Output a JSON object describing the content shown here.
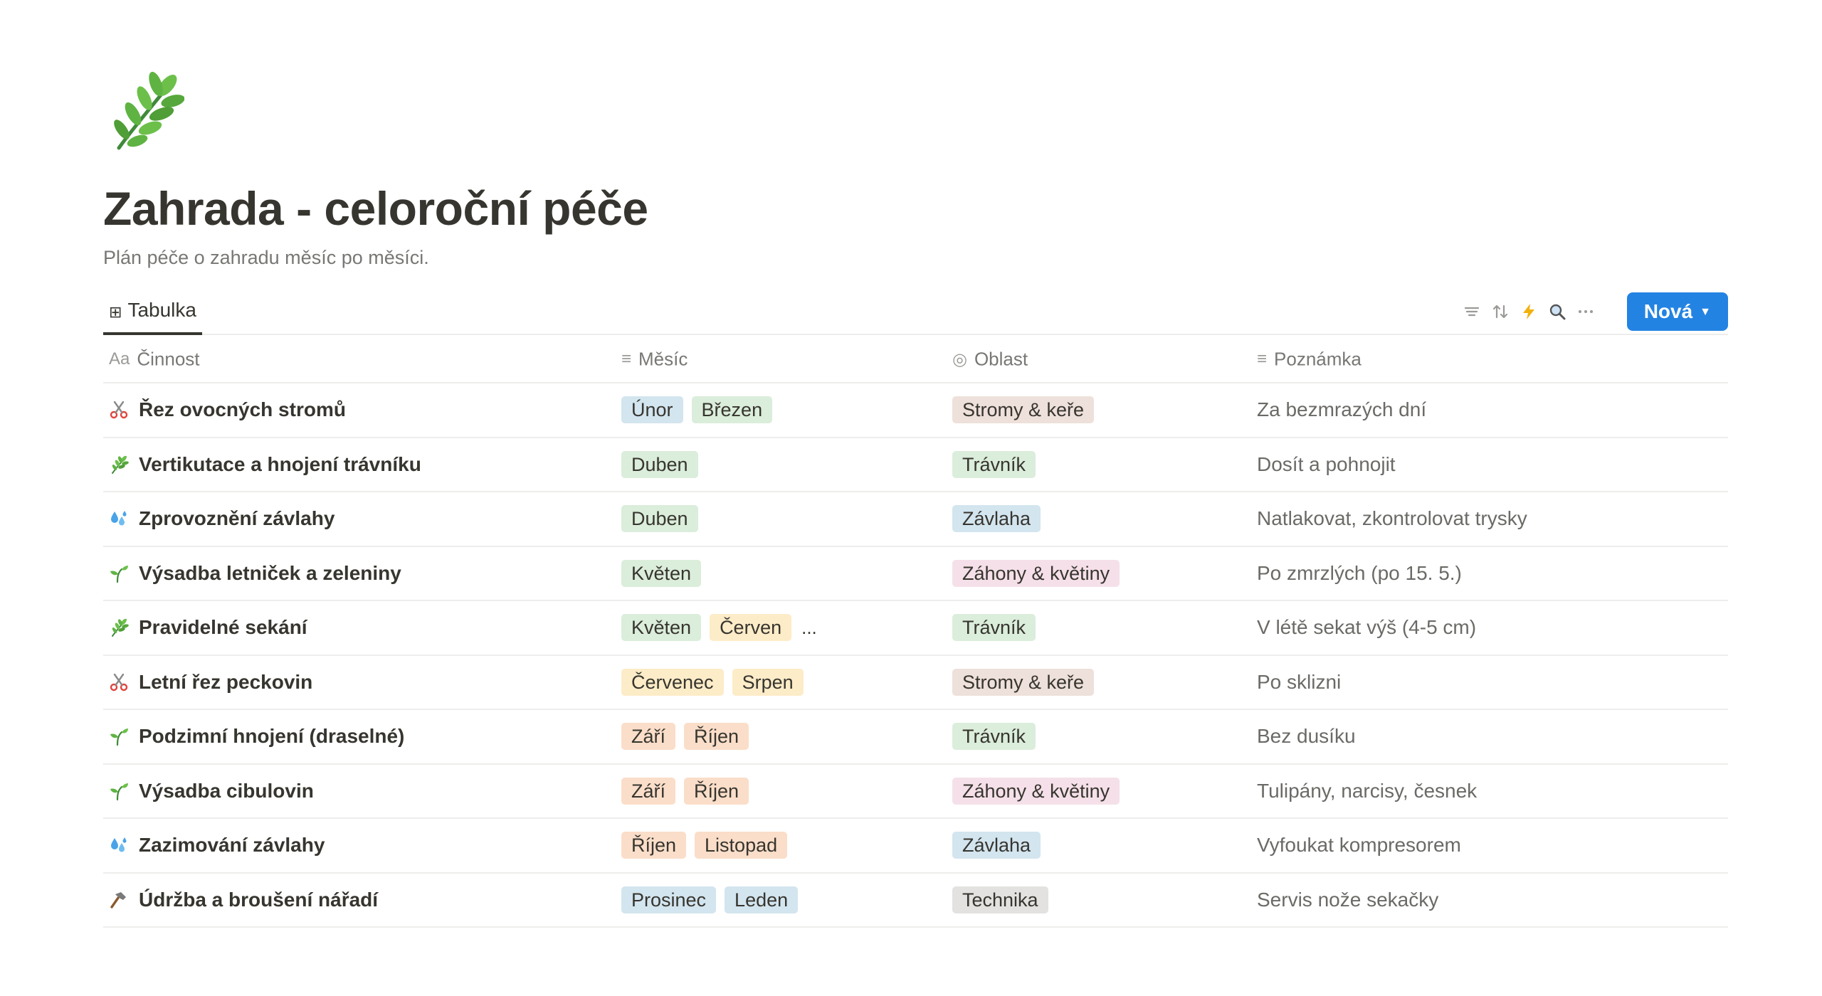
{
  "page": {
    "icon": "herb-icon",
    "title": "Zahrada - celoroční péče",
    "description": "Plán péče o zahradu měsíc po měsíci."
  },
  "view": {
    "tab_label": "Tabulka",
    "tab_icon": "table-icon",
    "tools": [
      "filter-icon",
      "sort-icon",
      "automation-lightning-icon",
      "search-icon",
      "more-options-icon"
    ],
    "new_button": "Nová"
  },
  "columns": [
    {
      "label": "Činnost",
      "icon_text": "Aa"
    },
    {
      "label": "Měsíc",
      "icon_text": "≡"
    },
    {
      "label": "Oblast",
      "icon_text": "◎"
    },
    {
      "label": "Poznámka",
      "icon_text": "≡"
    }
  ],
  "colors": {
    "accent": "#2383e2",
    "tag_blue": "#d3e5ef",
    "tag_green": "#dbeddb",
    "tag_yellow": "#fdecc8",
    "tag_orange": "#fadec9",
    "tag_brown": "#eee0da",
    "tag_pink": "#f5e0e9",
    "tag_gray": "#e3e2e0"
  },
  "rows": [
    {
      "icon": "scissors-icon",
      "name": "Řez ovocných stromů",
      "months": [
        {
          "label": "Únor",
          "color": "#d3e5ef"
        },
        {
          "label": "Březen",
          "color": "#dbeddb"
        }
      ],
      "more": "",
      "area": {
        "label": "Stromy & keře",
        "color": "#eee0da"
      },
      "note": "Za bezmrazých dní"
    },
    {
      "icon": "herb-icon",
      "name": "Vertikutace a hnojení trávníku",
      "months": [
        {
          "label": "Duben",
          "color": "#dbeddb"
        }
      ],
      "more": "",
      "area": {
        "label": "Trávník",
        "color": "#dbeddb"
      },
      "note": "Dosít a pohnojit"
    },
    {
      "icon": "water-droplets-icon",
      "name": "Zprovoznění závlahy",
      "months": [
        {
          "label": "Duben",
          "color": "#dbeddb"
        }
      ],
      "more": "",
      "area": {
        "label": "Závlaha",
        "color": "#d3e5ef"
      },
      "note": "Natlakovat, zkontrolovat trysky"
    },
    {
      "icon": "seedling-icon",
      "name": "Výsadba letniček a zeleniny",
      "months": [
        {
          "label": "Květen",
          "color": "#dbeddb"
        }
      ],
      "more": "",
      "area": {
        "label": "Záhony & květiny",
        "color": "#f5e0e9"
      },
      "note": "Po zmrzlých (po 15. 5.)"
    },
    {
      "icon": "herb-icon",
      "name": "Pravidelné sekání",
      "months": [
        {
          "label": "Květen",
          "color": "#dbeddb"
        },
        {
          "label": "Červen",
          "color": "#fdecc8"
        }
      ],
      "more": "...",
      "area": {
        "label": "Trávník",
        "color": "#dbeddb"
      },
      "note": "V létě sekat výš (4-5 cm)"
    },
    {
      "icon": "scissors-icon",
      "name": "Letní řez peckovin",
      "months": [
        {
          "label": "Červenec",
          "color": "#fdecc8"
        },
        {
          "label": "Srpen",
          "color": "#fdecc8"
        }
      ],
      "more": "",
      "area": {
        "label": "Stromy & keře",
        "color": "#eee0da"
      },
      "note": "Po sklizni"
    },
    {
      "icon": "seedling-icon",
      "name": "Podzimní hnojení (draselné)",
      "months": [
        {
          "label": "Září",
          "color": "#fadec9"
        },
        {
          "label": "Říjen",
          "color": "#fadec9"
        }
      ],
      "more": "",
      "area": {
        "label": "Trávník",
        "color": "#dbeddb"
      },
      "note": "Bez dusíku"
    },
    {
      "icon": "seedling-icon",
      "name": "Výsadba cibulovin",
      "months": [
        {
          "label": "Září",
          "color": "#fadec9"
        },
        {
          "label": "Říjen",
          "color": "#fadec9"
        }
      ],
      "more": "",
      "area": {
        "label": "Záhony & květiny",
        "color": "#f5e0e9"
      },
      "note": "Tulipány, narcisy, česnek"
    },
    {
      "icon": "water-droplets-icon",
      "name": "Zazimování závlahy",
      "months": [
        {
          "label": "Říjen",
          "color": "#fadec9"
        },
        {
          "label": "Listopad",
          "color": "#fadec9"
        }
      ],
      "more": "",
      "area": {
        "label": "Závlaha",
        "color": "#d3e5ef"
      },
      "note": "Vyfoukat kompresorem"
    },
    {
      "icon": "hammer-icon",
      "name": "Údržba a broušení nářadí",
      "months": [
        {
          "label": "Prosinec",
          "color": "#d3e5ef"
        },
        {
          "label": "Leden",
          "color": "#d3e5ef"
        }
      ],
      "more": "",
      "area": {
        "label": "Technika",
        "color": "#e3e2e0"
      },
      "note": "Servis nože sekačky"
    }
  ]
}
